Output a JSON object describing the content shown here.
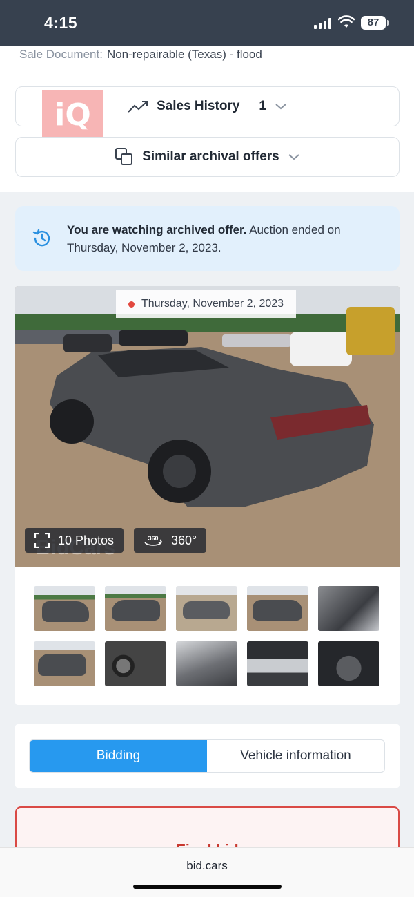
{
  "status_bar": {
    "time": "4:15",
    "battery": "87"
  },
  "sale_document": {
    "label": "Sale Document:",
    "value": "Non-repairable (Texas) - flood"
  },
  "watermark_logo": "iQ",
  "accordions": {
    "sales_history": {
      "label": "Sales History",
      "count": "1"
    },
    "similar_offers": {
      "label": "Similar archival offers"
    }
  },
  "notice": {
    "bold": "You are watching archived offer.",
    "text": " Auction ended on Thursday, November 2, 2023."
  },
  "gallery": {
    "date": "Thursday, November 2, 2023",
    "photos_button": "10 Photos",
    "three60_button": "360°",
    "three60_icon_label": "360",
    "watermark": "BidCars"
  },
  "tabs": {
    "bidding": "Bidding",
    "vehicle_info": "Vehicle information"
  },
  "final_bid": {
    "label": "Final bid"
  },
  "browser": {
    "url": "bid.cars"
  },
  "colors": {
    "accent": "#2799ef",
    "danger": "#d94a45",
    "status_bar": "#37414f"
  }
}
